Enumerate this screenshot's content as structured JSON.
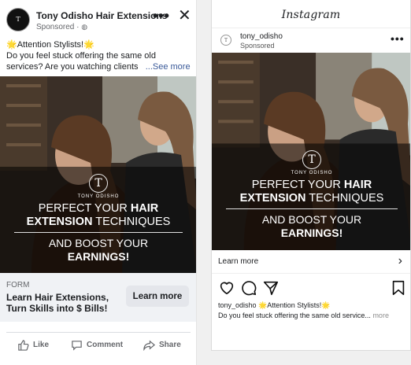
{
  "facebook": {
    "avatar_text": "TONY ODISHO",
    "page_name": "Tony Odisho Hair Extensions",
    "sponsored": "Sponsored ·",
    "more_icon": "more-horizontal-icon",
    "close_icon": "close-icon",
    "primary_text_line1": "🌟Attention Stylists!🌟",
    "primary_text_line2": "Do you feel stuck offering the same old",
    "primary_text_line3": "services? Are you watching clients",
    "see_more": "...See more",
    "form_label": "FORM",
    "form_title_line1": "Learn Hair Extensions,",
    "form_title_line2": "Turn Skills into $ Bills!",
    "cta_button": "Learn more",
    "actions": {
      "like": "Like",
      "comment": "Comment",
      "share": "Share"
    }
  },
  "ad_creative": {
    "logo_monogram": "T",
    "logo_text": "TONY ODISHO",
    "headline_part1": "PERFECT YOUR ",
    "headline_bold1": "HAIR",
    "headline_bold2": "EXTENSION",
    "headline_part2": " TECHNIQUES",
    "sub_part1": "AND BOOST YOUR",
    "sub_bold": "EARNINGS!"
  },
  "instagram": {
    "app_title": "Instagram",
    "avatar_text": "TO",
    "username": "tony_odisho",
    "sponsored": "Sponsored",
    "learn_more": "Learn more",
    "caption_user": "tony_odisho",
    "caption_text": " 🌟Attention Stylists!🌟",
    "caption_line2": "Do you feel stuck offering the same old service...",
    "caption_more": " more"
  },
  "colors": {
    "fb_link": "#385898",
    "fb_gray": "#65676b",
    "ad_dark": "#2b241f"
  }
}
